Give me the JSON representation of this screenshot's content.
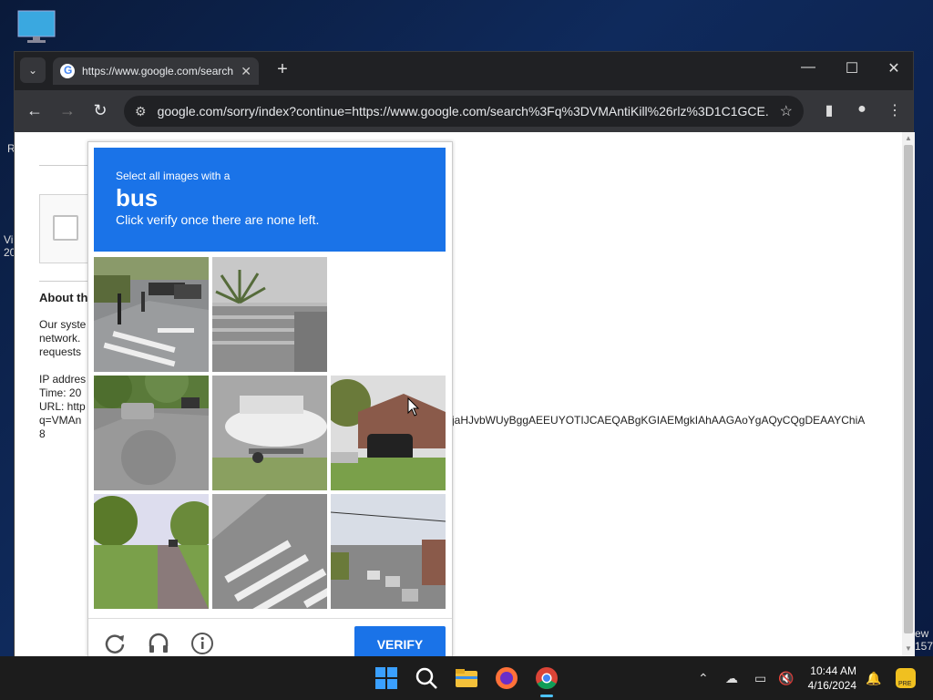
{
  "desktop": {
    "left_fragments": [
      "R",
      "Vi",
      "20"
    ],
    "right_fragments": [
      "ew",
      "157"
    ]
  },
  "browser": {
    "tab_title": "https://www.google.com/search",
    "url": "google.com/sorry/index?continue=https://www.google.com/search%3Fq%3DVMAntiKill%26rlz%3D1C1GCE..."
  },
  "page": {
    "about_heading": "About th",
    "para_lines": [
      "Our syste",
      "network.",
      "requests"
    ],
    "ip_line": "IP addres",
    "time_line": "Time: 20",
    "url_line": "URL: http",
    "q_line": "q=VMAn",
    "eight": "8",
    "long_token": "jaHJvbWUyBggAEEUYOTIJCAEQABgKGIAEMgkIAhAAGAoYgAQyCQgDEAAYChiA"
  },
  "captcha": {
    "instruction": "Select all images with a",
    "target": "bus",
    "subtext": "Click verify once there are none left.",
    "verify_label": "VERIFY",
    "tiles": [
      {
        "name": "tile-crosswalk-street"
      },
      {
        "name": "tile-yucca-plant"
      },
      {
        "name": "tile-blank"
      },
      {
        "name": "tile-tree-lined-street"
      },
      {
        "name": "tile-boat-trailer"
      },
      {
        "name": "tile-house-car"
      },
      {
        "name": "tile-park-road"
      },
      {
        "name": "tile-crosswalk-corner"
      },
      {
        "name": "tile-city-traffic"
      }
    ]
  },
  "taskbar": {
    "time": "10:44 AM",
    "date": "4/16/2024"
  }
}
